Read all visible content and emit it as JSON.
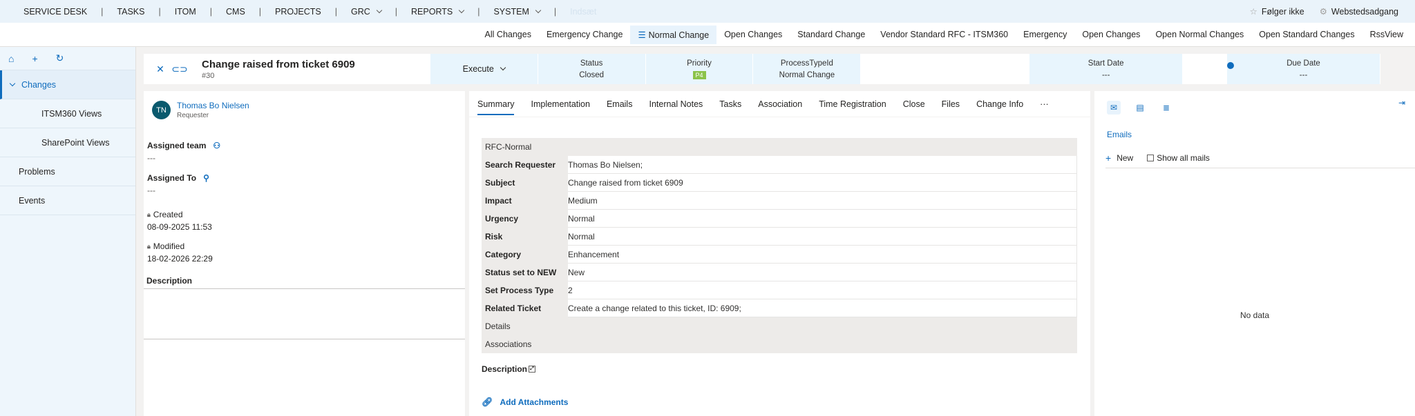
{
  "topnav": {
    "items": [
      "SERVICE DESK",
      "TASKS",
      "ITOM",
      "CMS",
      "PROJECTS",
      "GRC",
      "REPORTS",
      "SYSTEM"
    ],
    "separator": "|",
    "ghost": "Indsæt",
    "follow": "Følger ikke",
    "site_access": "Webstedsadgang"
  },
  "viewtabs": [
    "All Changes",
    "Emergency Change",
    "Normal Change",
    "Open Changes",
    "Standard Change",
    "Vendor Standard RFC - ITSM360",
    "Emergency",
    "Open Changes",
    "Open Normal Changes",
    "Open Standard Changes",
    "RssView"
  ],
  "sidebar": {
    "changes": "Changes",
    "children": [
      "ITSM360 Views",
      "SharePoint Views"
    ],
    "top_items": [
      "Problems",
      "Events"
    ]
  },
  "header": {
    "title": "Change raised from ticket 6909",
    "number": "#30",
    "execute": "Execute",
    "status_label": "Status",
    "status_value": "Closed",
    "priority_label": "Priority",
    "priority_value": "P4",
    "process_label": "ProcessTypeId",
    "process_value": "Normal Change",
    "start_label": "Start Date",
    "start_value": "---",
    "due_label": "Due Date",
    "due_value": "---"
  },
  "left": {
    "initials": "TN",
    "name": "Thomas Bo Nielsen",
    "role": "Requester",
    "assigned_team_label": "Assigned team",
    "assigned_team_value": "---",
    "assigned_to_label": "Assigned To",
    "assigned_to_value": "---",
    "created_label": "Created",
    "created_value": "08-09-2025 11:53",
    "modified_label": "Modified",
    "modified_value": "18-02-2026 22:29",
    "description_label": "Description"
  },
  "tabs": [
    "Summary",
    "Implementation",
    "Emails",
    "Internal Notes",
    "Tasks",
    "Association",
    "Time Registration",
    "Close",
    "Files",
    "Change Info",
    "···"
  ],
  "form": {
    "section": "RFC-Normal",
    "rows": [
      {
        "k": "Search Requester",
        "v": "Thomas Bo Nielsen;"
      },
      {
        "k": "Subject",
        "v": "Change raised from ticket 6909"
      },
      {
        "k": "Impact",
        "v": "Medium"
      },
      {
        "k": "Urgency",
        "v": "Normal"
      },
      {
        "k": "Risk",
        "v": "Normal"
      },
      {
        "k": "Category",
        "v": "Enhancement"
      },
      {
        "k": "Status set to NEW",
        "v": "New"
      },
      {
        "k": "Set Process Type",
        "v": "2"
      },
      {
        "k": "Related Ticket",
        "v": "Create a change related to this ticket, ID: 6909;"
      }
    ],
    "details": "Details",
    "associations": "Associations",
    "description": "Description",
    "add_attachments": "Add Attachments"
  },
  "right": {
    "emails_title": "Emails",
    "new": "New",
    "show_all": "Show all mails",
    "no_data": "No data"
  },
  "colors": {
    "accent": "#0f6cbd",
    "priority": "#8bc34a",
    "header_cell": "#e8f5fd"
  }
}
